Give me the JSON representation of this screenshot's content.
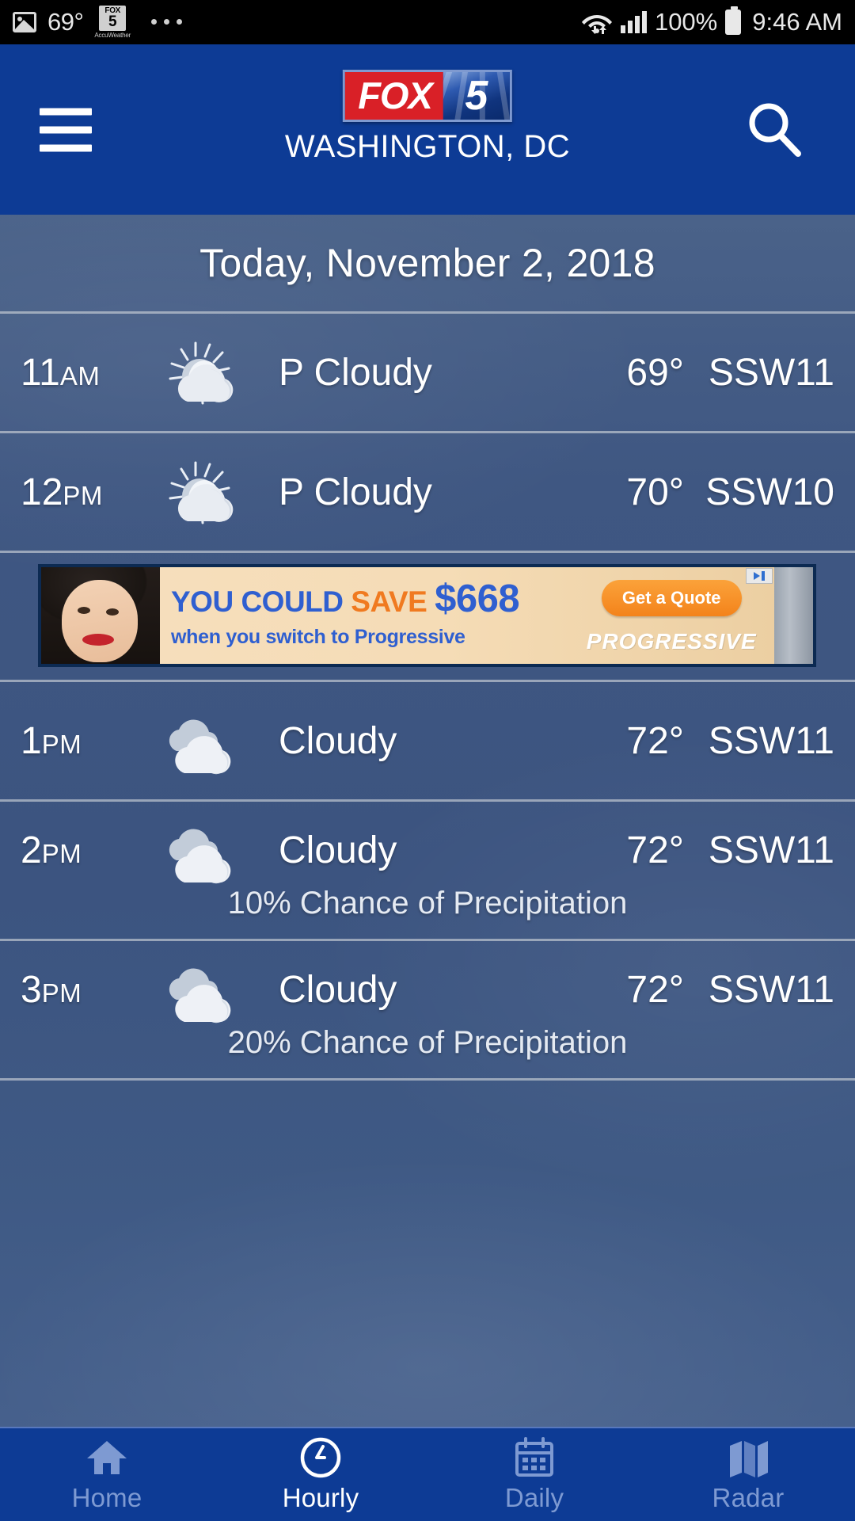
{
  "status_bar": {
    "image_icon": "image-icon",
    "temperature": "69°",
    "app_badge": {
      "line1": "FOX",
      "line2": "5",
      "caption": "AccuWeather"
    },
    "overflow": "more-notifications-dots",
    "wifi_icon": "wifi-icon",
    "signal_icon": "cell-signal-icon",
    "battery_percent": "100%",
    "battery_icon": "battery-full-icon",
    "time": "9:46 AM"
  },
  "header": {
    "menu_icon": "hamburger-menu-icon",
    "logo": {
      "fox": "FOX",
      "five": "5"
    },
    "city": "WASHINGTON, DC",
    "search_icon": "search-icon",
    "background_color": "#0d3b95"
  },
  "main": {
    "date_title": "Today, November 2, 2018",
    "hours": [
      {
        "time": "11",
        "meridiem": "AM",
        "icon": "partly-cloudy-icon",
        "condition": "P Cloudy",
        "temp": "69°",
        "wind": "SSW11",
        "precip": ""
      },
      {
        "time": "12",
        "meridiem": "PM",
        "icon": "partly-cloudy-icon",
        "condition": "P Cloudy",
        "temp": "70°",
        "wind": "SSW10",
        "precip": ""
      },
      {
        "time": "1",
        "meridiem": "PM",
        "icon": "cloudy-icon",
        "condition": "Cloudy",
        "temp": "72°",
        "wind": "SSW11",
        "precip": ""
      },
      {
        "time": "2",
        "meridiem": "PM",
        "icon": "cloudy-icon",
        "condition": "Cloudy",
        "temp": "72°",
        "wind": "SSW11",
        "precip": "10% Chance of Precipitation"
      },
      {
        "time": "3",
        "meridiem": "PM",
        "icon": "cloudy-icon",
        "condition": "Cloudy",
        "temp": "72°",
        "wind": "SSW11",
        "precip": "20% Chance of Precipitation"
      }
    ]
  },
  "ad": {
    "headline_part1": "YOU COULD ",
    "headline_save": "SAVE",
    "headline_amount": "$668",
    "subline": "when you switch to Progressive",
    "cta": "Get a Quote",
    "brand": "PROGRESSIVE",
    "adchoices_icon": "adchoices-icon"
  },
  "bottom_nav": {
    "items": [
      {
        "label": "Home",
        "icon": "home-icon",
        "active": false
      },
      {
        "label": "Hourly",
        "icon": "clock-icon",
        "active": true
      },
      {
        "label": "Daily",
        "icon": "calendar-icon",
        "active": false
      },
      {
        "label": "Radar",
        "icon": "map-icon",
        "active": false
      }
    ]
  },
  "colors": {
    "brand_blue": "#0d3b95",
    "accent_red": "#d92027",
    "body_blue": "#3f5782",
    "ad_orange": "#f3831b"
  }
}
